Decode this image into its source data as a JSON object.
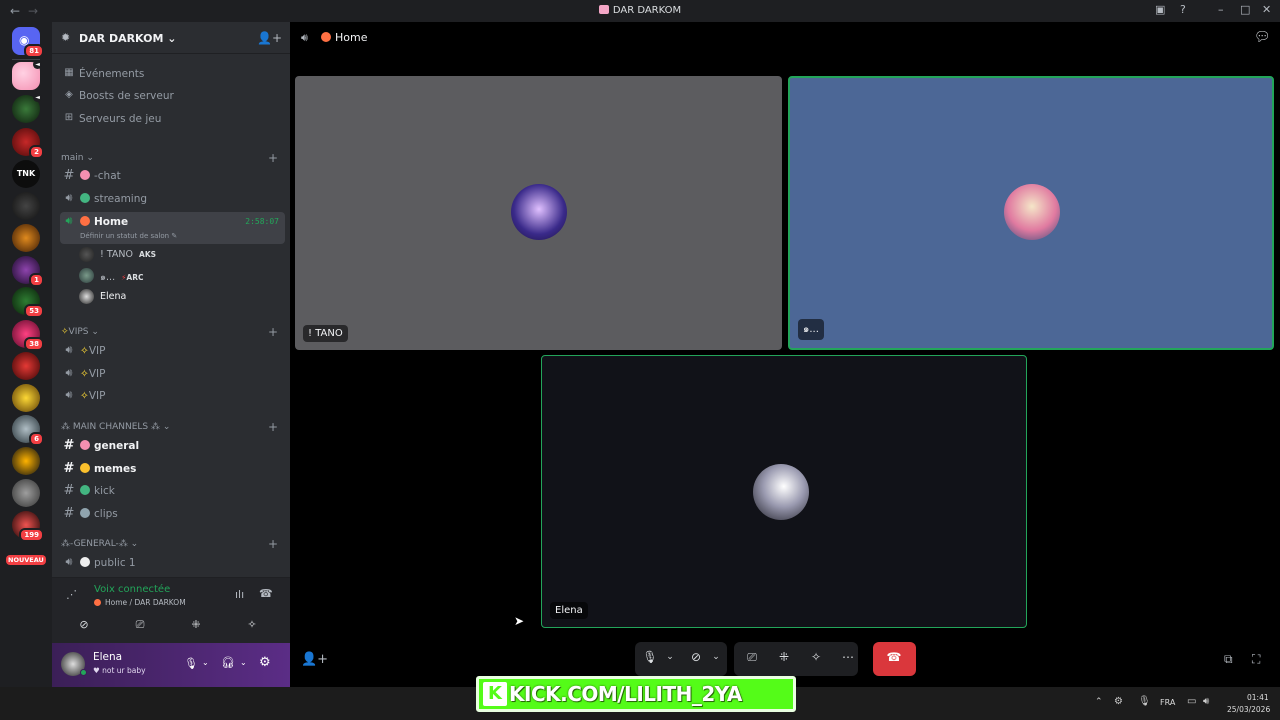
{
  "window": {
    "title": "DAR DARKOM"
  },
  "guilds": {
    "badges": [
      "81",
      "2",
      "1",
      "53",
      "38",
      "6",
      "199"
    ],
    "new_label": "NOUVEAU"
  },
  "server": {
    "name": "DAR DARKOM"
  },
  "server_links": [
    {
      "icon": "calendar-icon",
      "label": "Événements"
    },
    {
      "icon": "boost-icon",
      "label": "Boosts de serveur"
    },
    {
      "icon": "gamepad-icon",
      "label": "Serveurs de jeu"
    }
  ],
  "categories": {
    "main": "main",
    "vips": "VIPS",
    "main_channels": "MAIN CHANNELS",
    "general": "-GENERAL-"
  },
  "channels": {
    "chat": "-chat",
    "streaming": "streaming",
    "home": "Home",
    "home_timer": "2:58:07",
    "home_status": "Définir un statut de salon",
    "vip1": "VIP",
    "vip2": "VIP",
    "vip3": "VIP",
    "general": "general",
    "memes": "memes",
    "kick": "kick",
    "clips": "clips",
    "public1": "public 1"
  },
  "voice_users": [
    {
      "name": "! TANO",
      "tag": "AKS"
    },
    {
      "name": "๑...",
      "tag": "ARC"
    },
    {
      "name": "Elena",
      "tag": ""
    }
  ],
  "voice_panel": {
    "status": "Voix connectée",
    "location": "Home / DAR DARKOM"
  },
  "user": {
    "name": "Elena",
    "status": "not ur baby"
  },
  "main": {
    "channel_title": "Home",
    "tiles": [
      {
        "label": "! TANO"
      },
      {
        "label": "๑..."
      },
      {
        "label": "Elena"
      }
    ]
  },
  "overlay": {
    "kick_text": "KICK.COM/LILITH_2YA"
  },
  "taskbar": {
    "lang": "FRA",
    "time": "01:41",
    "date": "25/03/2026"
  },
  "colors": {
    "accent_green": "#23a55a",
    "hangup": "#da373c",
    "tile_blue": "#4c6796"
  }
}
